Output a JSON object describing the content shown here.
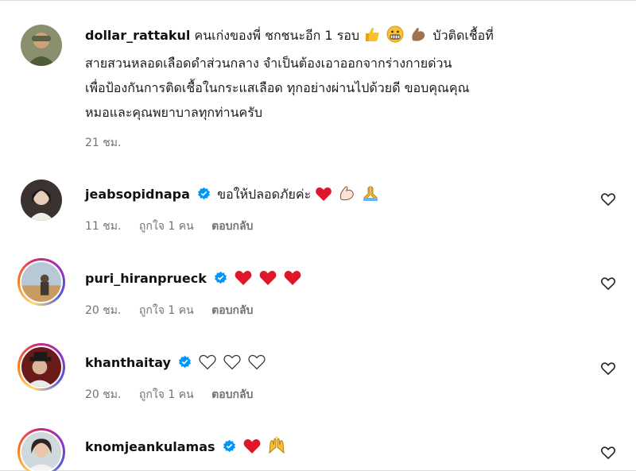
{
  "post": {
    "username": "dollar_rattakul",
    "caption": "คนเก่งของพี่ ชกชนะอีก 1 รอบ",
    "caption_emojis": [
      "thumbs-up",
      "grimacing-face",
      "flexed-biceps"
    ],
    "caption_rest_line1": "บัวติดเชื้อที่",
    "caption_line2": "สายสวนหลอดเลือดดำส่วนกลาง จำเป็นต้องเอาออกจากร่างกายด่วน",
    "caption_line3": "เพื่อป้องกันการติดเชื้อในกระแสเลือด ทุกอย่างผ่านไปด้วยดี ขอบคุณคุณ",
    "caption_line4": "หมอและคุณพยาบาลทุกท่านครับ",
    "time": "21 ชม."
  },
  "comments": [
    {
      "username": "jeabsopidnapa",
      "verified": true,
      "text": "ขอให้ปลอดภัยค่ะ",
      "emojis": [
        "red-heart",
        "flexed-biceps",
        "folded-hands"
      ],
      "time": "11 ชม.",
      "likes": "ถูกใจ 1 คน",
      "reply": "ตอบกลับ"
    },
    {
      "username": "puri_hiranprueck",
      "verified": true,
      "text": "",
      "emojis": [
        "red-heart",
        "red-heart",
        "red-heart"
      ],
      "time": "20 ชม.",
      "likes": "ถูกใจ 1 คน",
      "reply": "ตอบกลับ"
    },
    {
      "username": "khanthaitay",
      "verified": true,
      "text": "",
      "emojis": [
        "white-heart",
        "white-heart",
        "white-heart"
      ],
      "time": "20 ชม.",
      "likes": "ถูกใจ 1 คน",
      "reply": "ตอบกลับ"
    },
    {
      "username": "knomjeankulamas",
      "verified": true,
      "text": "",
      "emojis": [
        "red-heart",
        "raising-hands"
      ],
      "time": "",
      "likes": "",
      "reply": ""
    }
  ],
  "colors": {
    "verified_blue": "#0095f6",
    "meta_gray": "#737373",
    "heart_red": "#e0162b"
  }
}
